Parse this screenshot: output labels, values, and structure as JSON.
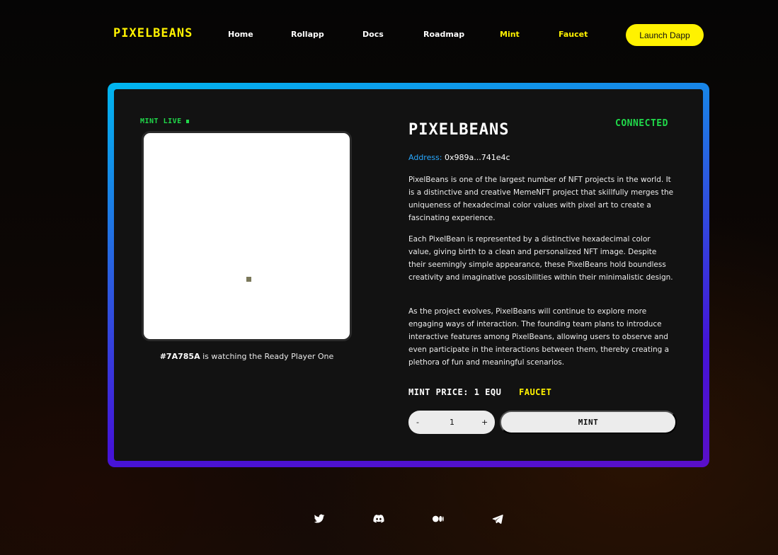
{
  "header": {
    "logo": "PIXELBEANS",
    "nav": [
      {
        "label": "Home",
        "active": false
      },
      {
        "label": "Rollapp",
        "active": false
      },
      {
        "label": "Docs",
        "active": false
      },
      {
        "label": "Roadmap",
        "active": false
      },
      {
        "label": "Mint",
        "active": true
      },
      {
        "label": "Faucet",
        "active": true
      }
    ],
    "launch_label": "Launch Dapp"
  },
  "preview": {
    "status": "MINT LIVE",
    "caption_hex": "#7A785A",
    "caption_text": " is watching the Ready Player One",
    "pixel_color": "#7a785a"
  },
  "info": {
    "title": "PIXELBEANS",
    "connection_status": "CONNECTED",
    "address_label": "Address:",
    "address_value": "0x989a...741e4c",
    "paragraphs": [
      "PixelBeans is one of the largest number of NFT projects in the world. It is a distinctive and creative MemeNFT project that skillfully merges the uniqueness of hexadecimal color values with pixel art to create a fascinating experience.",
      "Each PixelBean is represented by a distinctive hexadecimal color value, giving birth to a clean and personalized NFT image. Despite their seemingly simple appearance, these PixelBeans hold boundless creativity and imaginative possibilities within their minimalistic design.",
      "As the project evolves, PixelBeans will continue to explore more engaging ways of interaction. The founding team plans to introduce interactive features among PixelBeans, allowing users to observe and even participate in the interactions between them, thereby creating a plethora of fun and meaningful scenarios."
    ],
    "mint_price": "MINT PRICE: 1 EQU",
    "faucet_label": "FAUCET"
  },
  "controls": {
    "decrement": "-",
    "quantity": "1",
    "increment": "+",
    "mint_label": "MINT"
  },
  "footer": {
    "icons": [
      "twitter-icon",
      "discord-icon",
      "medium-icon",
      "telegram-icon"
    ]
  },
  "colors": {
    "accent": "#fff200",
    "live_green": "#20d94a",
    "address_blue": "#28a8ff",
    "border_start": "#00b7f0",
    "border_end": "#5a0fc8"
  }
}
